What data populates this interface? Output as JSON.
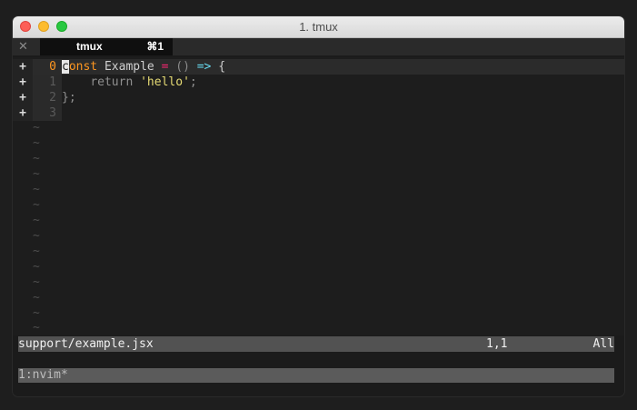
{
  "window": {
    "title": "1. tmux",
    "tab": {
      "close_glyph": "✕",
      "label": "tmux",
      "shortcut": "⌘1"
    }
  },
  "editor": {
    "lines": [
      {
        "sign": "+",
        "number": "0",
        "before_cursor": "",
        "cursor_char": "c",
        "keyword_rest": "onst",
        "identifier": " Example ",
        "operator": "=",
        "parens": " ()",
        "arrow": " =>",
        "tail": " {"
      },
      {
        "sign": "+",
        "number": "1",
        "indent": "    ",
        "keyword": "return",
        "string": "'hello'",
        "semicolon": ";"
      },
      {
        "sign": "+",
        "number": "2",
        "text": "};"
      },
      {
        "sign": "+",
        "number": "3",
        "text": ""
      }
    ],
    "tilde": "~"
  },
  "statusline": {
    "file": "support/example.jsx",
    "position": "1,1",
    "scroll": "All"
  },
  "tmux": {
    "window_label": "1:nvim*"
  },
  "colors": {
    "keyword": "#fd9620",
    "operator": "#f92672",
    "arrow": "#66d9ef",
    "string": "#e6db74",
    "current_line_number": "#fd9620"
  }
}
